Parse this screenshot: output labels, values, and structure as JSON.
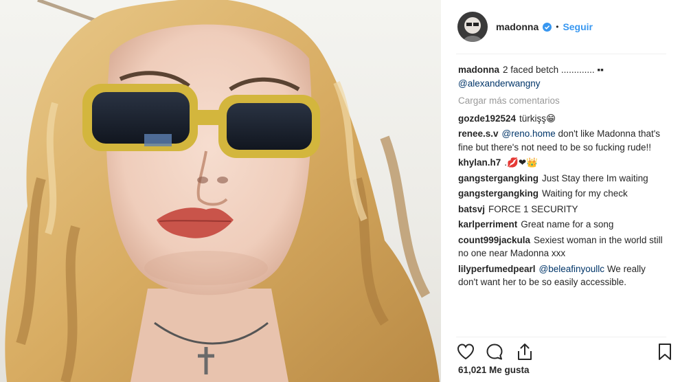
{
  "post": {
    "author": "madonna",
    "follow_label": "Seguir",
    "separator": "•",
    "caption_user": "madonna",
    "caption_text": "2 faced betch ............. ▪▪",
    "caption_mention": "@alexanderwangny",
    "load_more": "Cargar más comentarios",
    "likes": "61,021 Me gusta"
  },
  "comments": [
    {
      "user": "gozde192524",
      "pre": "",
      "mention": "",
      "text": "türkişş😁"
    },
    {
      "user": "renee.s.v",
      "pre": "",
      "mention": "@reno.home",
      "text": " don't like Madonna that's fine but there's not need to be so fucking rude!!"
    },
    {
      "user": "khylan.h7",
      "pre": "",
      "mention": "",
      "text": ".💋❤👑"
    },
    {
      "user": "gangstergangking",
      "pre": "",
      "mention": "",
      "text": "Just Stay there Im waiting"
    },
    {
      "user": "gangstergangking",
      "pre": "",
      "mention": "",
      "text": "Waiting for my check"
    },
    {
      "user": "batsvj",
      "pre": "",
      "mention": "",
      "text": "FORCE 1 SECURITY"
    },
    {
      "user": "karlperriment",
      "pre": "",
      "mention": "",
      "text": "Great name for a song"
    },
    {
      "user": "count999jackula",
      "pre": "",
      "mention": "",
      "text": "Sexiest woman in the world still no one near Madonna xxx"
    },
    {
      "user": "lilyperfumedpearl",
      "pre": "",
      "mention": "@beleafinyoullc",
      "text": " We really don't want her to be so easily accessible."
    }
  ],
  "icons": {
    "like": "heart-icon",
    "comment": "comment-icon",
    "share": "share-icon",
    "save": "bookmark-icon",
    "verified": "verified-badge-icon"
  },
  "colors": {
    "link": "#3897f0",
    "mention": "#003569",
    "muted": "#999999",
    "text": "#262626"
  }
}
